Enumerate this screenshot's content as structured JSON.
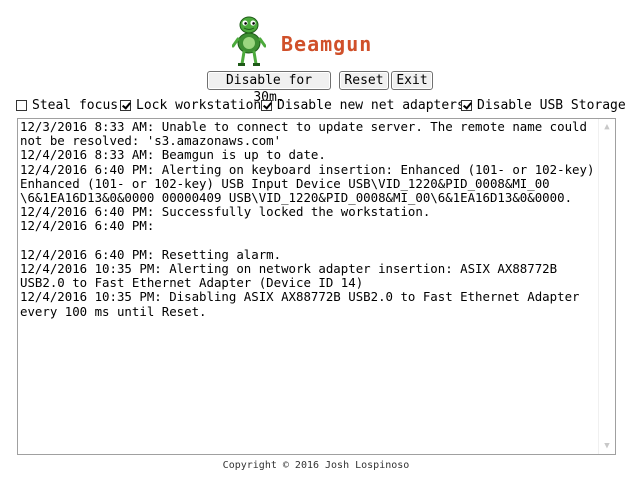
{
  "header": {
    "title": "Beamgun",
    "logo_icon": "turtle-mascot-icon"
  },
  "toolbar": {
    "disable_label": "Disable for 30m.",
    "reset_label": "Reset",
    "exit_label": "Exit"
  },
  "options": [
    {
      "label": "Steal focus",
      "checked": false
    },
    {
      "label": "Lock workstation",
      "checked": true
    },
    {
      "label": "Disable new net adapters",
      "checked": true
    },
    {
      "label": "Disable USB Storage",
      "checked": true
    }
  ],
  "log": {
    "text": "12/3/2016 8:33 AM: Unable to connect to update server. The remote name could not be resolved: 's3.amazonaws.com'\n12/4/2016 8:33 AM: Beamgun is up to date.\n12/4/2016 6:40 PM: Alerting on keyboard insertion: Enhanced (101- or 102-key) Enhanced (101- or 102-key) USB Input Device USB\\VID_1220&PID_0008&MI_00 \\6&1EA16D13&0&0000 00000409 USB\\VID_1220&PID_0008&MI_00\\6&1EA16D13&0&0000.\n12/4/2016 6:40 PM: Successfully locked the workstation.\n12/4/2016 6:40 PM:\n\n12/4/2016 6:40 PM: Resetting alarm.\n12/4/2016 10:35 PM: Alerting on network adapter insertion: ASIX AX88772B USB2.0 to Fast Ethernet Adapter (Device ID 14)\n12/4/2016 10:35 PM: Disabling ASIX AX88772B USB2.0 to Fast Ethernet Adapter every 100 ms until Reset."
  },
  "footer": {
    "copyright": "Copyright © 2016 Josh Lospinoso"
  },
  "colors": {
    "title": "#d0502a",
    "logo_green": "#4caa3c"
  }
}
